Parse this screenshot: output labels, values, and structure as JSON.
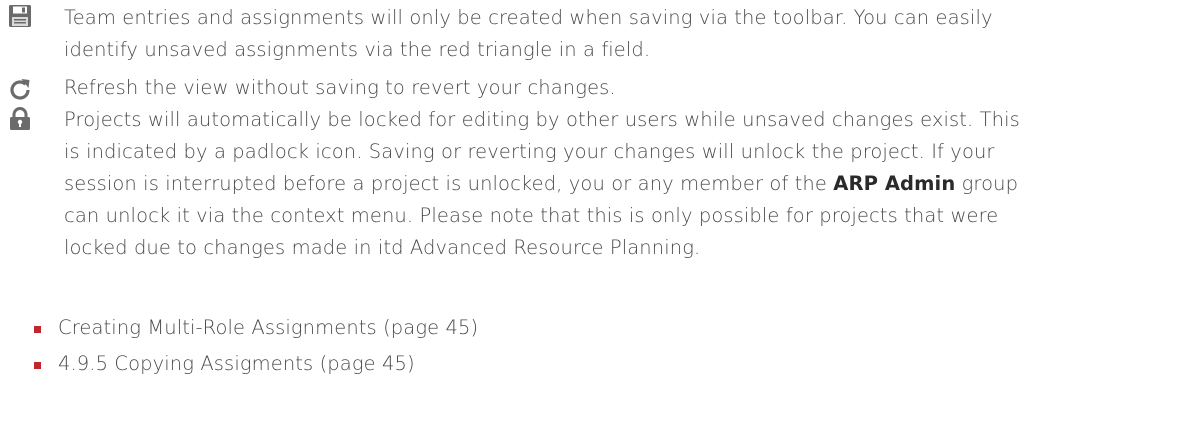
{
  "entries": [
    {
      "icon": "floppy-disk-save-icon",
      "lines": [
        "Team entries and assignments will only be created when saving via the toolbar. You can easily",
        "identify unsaved assignments via the red triangle in a field."
      ]
    },
    {
      "icon": "refresh-icon",
      "lines": [
        "Refresh the view without saving to revert your changes."
      ]
    },
    {
      "icon": "padlock-icon",
      "lines": [
        "Projects will automatically be locked for editing by other users while unsaved changes exist. This",
        "is indicated by a padlock icon. Saving or reverting your changes will unlock the project. If your",
        "session is interrupted before a project is unlocked, you or any member of the ",
        "group",
        "can unlock it via the context menu. Please note that this is only possible for projects that were",
        "locked due to changes made in itd Advanced Resource Planning."
      ],
      "bold_term": "ARP Admin"
    }
  ],
  "links": [
    {
      "label": "Creating Multi-Role Assignments (page 45)"
    },
    {
      "label": "4.9.5 Copying Assigments (page 45)"
    }
  ],
  "colors": {
    "text": "#4a4a4a",
    "bullet": "#c0262d",
    "icon": "#6b6b6b"
  }
}
